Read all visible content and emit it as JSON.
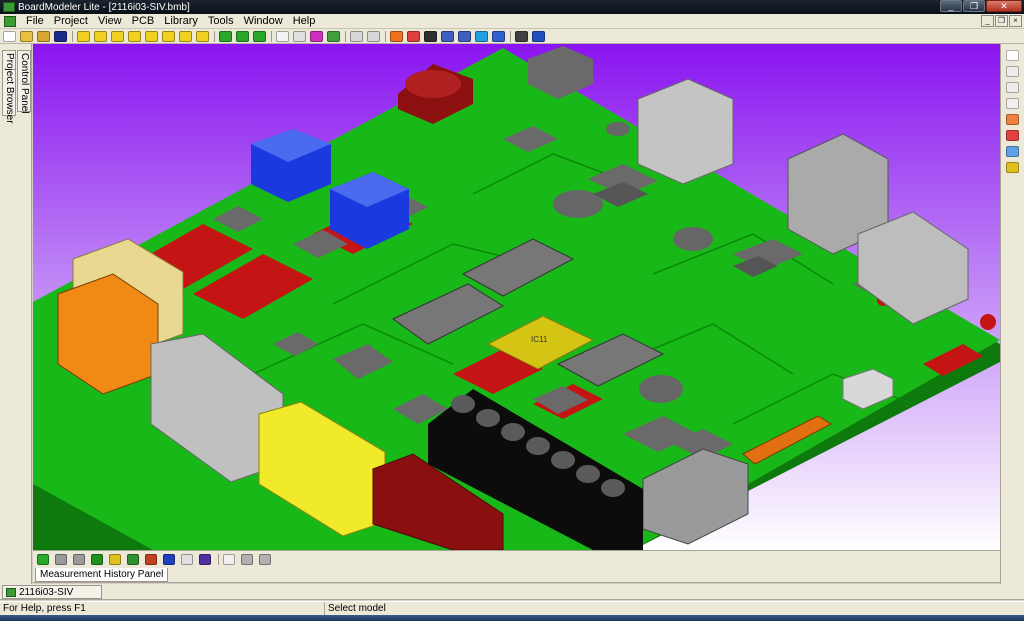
{
  "window": {
    "title": "BoardModeler Lite - [2116i03-SIV.bmb]",
    "minimize_glyph": "_",
    "maximize_glyph": "❐",
    "close_glyph": "✕"
  },
  "menu": {
    "items": [
      "File",
      "Project",
      "View",
      "PCB",
      "Library",
      "Tools",
      "Window",
      "Help"
    ],
    "mdi_minimize": "_",
    "mdi_restore": "❐",
    "mdi_close": "×"
  },
  "left_panel": {
    "tabs": [
      "Project Browser",
      "Control Panel"
    ]
  },
  "viewport": {
    "component_label": "IC11",
    "colors": {
      "board": "#18b818",
      "board_edge": "#0e7a0e",
      "pad": "#c41414",
      "ic": "#777777",
      "connector_gray": "#c0c0c0",
      "connector_yellow": "#f0ea2a",
      "connector_orange": "#f08a14",
      "connector_cream": "#e8d890",
      "inductor_blue": "#1a3ae0",
      "header_black": "#0c0c0c",
      "header_red": "#8a1010",
      "chip_gold": "#d4c414"
    }
  },
  "panels": {
    "measurement_tab": "Measurement History Panel"
  },
  "documents": {
    "active_tab": "2116i03-SIV"
  },
  "status": {
    "help_text": "For Help, press F1",
    "message": "Select model"
  }
}
